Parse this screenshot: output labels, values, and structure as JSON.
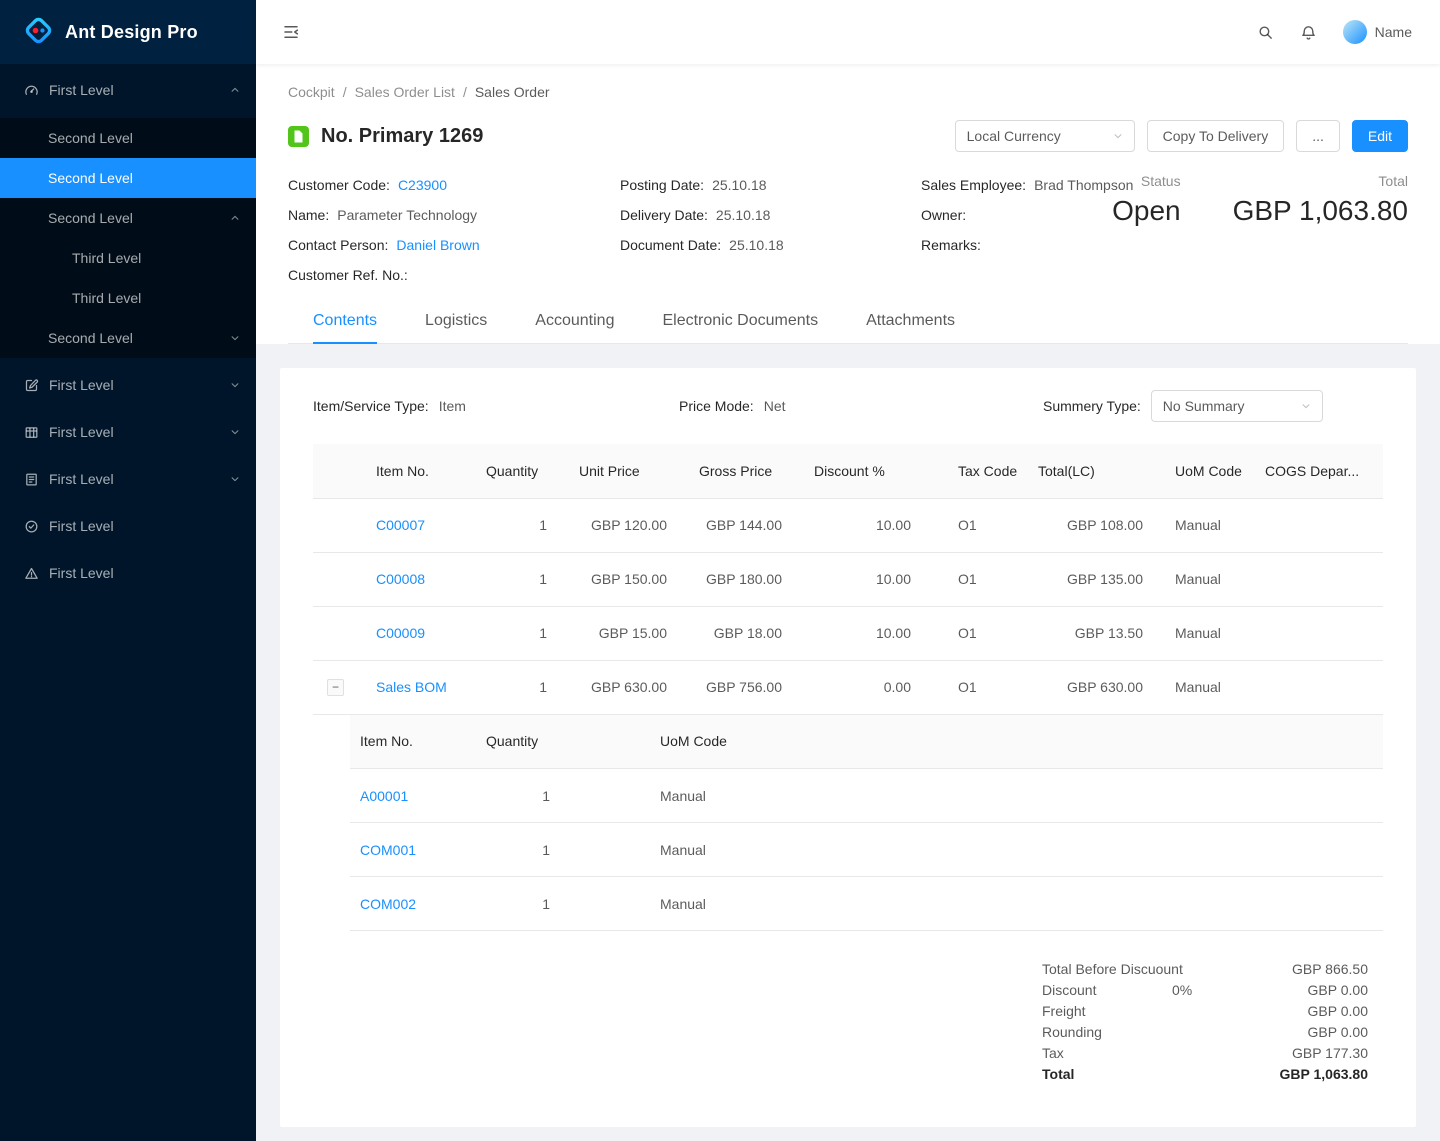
{
  "colors": {
    "primary": "#1890ff",
    "sidebar_bg": "#001529",
    "submenu_bg": "#000c17",
    "doc_icon_green": "#52c41a"
  },
  "sidebar": {
    "logo_text": "Ant Design Pro",
    "menu": [
      {
        "label": "First Level",
        "icon": "dashboard-icon",
        "state": "expanded",
        "children": [
          {
            "label": "Second Level"
          },
          {
            "label": "Second Level",
            "selected": true
          },
          {
            "label": "Second Level",
            "state": "expanded",
            "children": [
              {
                "label": "Third Level"
              },
              {
                "label": "Third Level"
              }
            ]
          },
          {
            "label": "Second Level",
            "state": "collapsed"
          }
        ]
      },
      {
        "label": "First Level",
        "icon": "edit-icon",
        "state": "collapsed"
      },
      {
        "label": "First Level",
        "icon": "table-icon",
        "state": "collapsed"
      },
      {
        "label": "First Level",
        "icon": "profile-icon",
        "state": "collapsed"
      },
      {
        "label": "First Level",
        "icon": "check-circle-icon"
      },
      {
        "label": "First Level",
        "icon": "warning-icon"
      }
    ]
  },
  "header": {
    "user_name": "Name"
  },
  "breadcrumb": {
    "items": [
      "Cockpit",
      "Sales Order List",
      "Sales Order"
    ],
    "separator": "/"
  },
  "page": {
    "title": "No. Primary 1269",
    "currency_select": "Local Currency",
    "copy_to_delivery": "Copy To Delivery",
    "more_button": "...",
    "edit_button": "Edit",
    "details": {
      "customer_code": {
        "label": "Customer Code:",
        "value": "C23900"
      },
      "name": {
        "label": "Name:",
        "value": "Parameter Technology"
      },
      "contact_person": {
        "label": "Contact Person:",
        "value": "Daniel Brown"
      },
      "customer_ref": {
        "label": "Customer Ref. No.:",
        "value": ""
      },
      "posting_date": {
        "label": "Posting Date:",
        "value": "25.10.18"
      },
      "delivery_date": {
        "label": "Delivery Date:",
        "value": "25.10.18"
      },
      "document_date": {
        "label": "Document Date:",
        "value": "25.10.18"
      },
      "sales_employee": {
        "label": "Sales Employee:",
        "value": "Brad Thompson"
      },
      "owner": {
        "label": "Owner:",
        "value": ""
      },
      "remarks": {
        "label": "Remarks:",
        "value": ""
      }
    },
    "status": {
      "label": "Status",
      "value": "Open"
    },
    "total": {
      "label": "Total",
      "value": "GBP 1,063.80"
    }
  },
  "tabs": {
    "items": [
      "Contents",
      "Logistics",
      "Accounting",
      "Electronic Documents",
      "Attachments"
    ],
    "active": "Contents"
  },
  "contents": {
    "item_service_type": {
      "label": "Item/Service Type:",
      "value": "Item"
    },
    "price_mode": {
      "label": "Price Mode:",
      "value": "Net"
    },
    "summary_type": {
      "label": "Summery Type:",
      "value": "No Summary"
    },
    "icons": {
      "collapse_row": "−"
    },
    "table": {
      "columns": [
        "Item No.",
        "Quantity",
        "Unit Price",
        "Gross Price",
        "Discount %",
        "Tax Code",
        "Total(LC)",
        "UoM Code",
        "COGS Depar..."
      ],
      "rows": [
        {
          "item_no": "C00007",
          "quantity": "1",
          "unit_price": "GBP 120.00",
          "gross_price": "GBP 144.00",
          "discount_pct": "10.00",
          "tax_code": "O1",
          "total_lc": "GBP 108.00",
          "uom_code": "Manual",
          "cogs": ""
        },
        {
          "item_no": "C00008",
          "quantity": "1",
          "unit_price": "GBP 150.00",
          "gross_price": "GBP 180.00",
          "discount_pct": "10.00",
          "tax_code": "O1",
          "total_lc": "GBP 135.00",
          "uom_code": "Manual",
          "cogs": ""
        },
        {
          "item_no": "C00009",
          "quantity": "1",
          "unit_price": "GBP 15.00",
          "gross_price": "GBP 18.00",
          "discount_pct": "10.00",
          "tax_code": "O1",
          "total_lc": "GBP 13.50",
          "uom_code": "Manual",
          "cogs": ""
        },
        {
          "item_no": "Sales BOM",
          "quantity": "1",
          "unit_price": "GBP 630.00",
          "gross_price": "GBP 756.00",
          "discount_pct": "0.00",
          "tax_code": "O1",
          "total_lc": "GBP 630.00",
          "uom_code": "Manual",
          "cogs": "",
          "expanded": true
        }
      ]
    },
    "bom_table": {
      "columns": [
        "Item No.",
        "Quantity",
        "UoM Code"
      ],
      "rows": [
        {
          "item_no": "A00001",
          "quantity": "1",
          "uom_code": "Manual"
        },
        {
          "item_no": "COM001",
          "quantity": "1",
          "uom_code": "Manual"
        },
        {
          "item_no": "COM002",
          "quantity": "1",
          "uom_code": "Manual"
        }
      ]
    },
    "totals": {
      "rows": [
        {
          "label": "Total Before Discuount",
          "extra": "",
          "value": "GBP 866.50"
        },
        {
          "label": "Discount",
          "extra": "0%",
          "value": "GBP 0.00"
        },
        {
          "label": "Freight",
          "extra": "",
          "value": "GBP 0.00"
        },
        {
          "label": "Rounding",
          "extra": "",
          "value": "GBP 0.00"
        },
        {
          "label": "Tax",
          "extra": "",
          "value": "GBP 177.30"
        },
        {
          "label": "Total",
          "extra": "",
          "value": "GBP 1,063.80"
        }
      ]
    }
  }
}
